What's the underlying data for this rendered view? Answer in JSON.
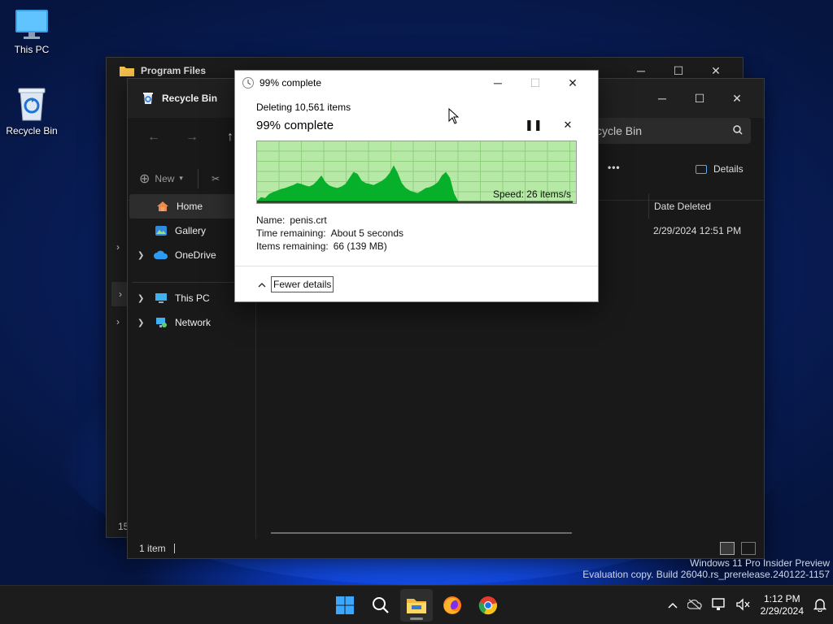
{
  "desktop": {
    "icons": [
      {
        "label": "This PC"
      },
      {
        "label": "Recycle Bin"
      }
    ]
  },
  "back_window": {
    "title": "Program Files",
    "status_count": "15"
  },
  "front_window": {
    "title": "Recycle Bin",
    "search_placeholder": "Search Recycle Bin",
    "search_visible": "cycle Bin",
    "new_label": "New",
    "details_label": "Details",
    "more_label": "•••",
    "nav": [
      {
        "label": "Home",
        "selected": true
      },
      {
        "label": "Gallery"
      },
      {
        "label": "OneDrive"
      },
      {
        "label": "This PC"
      },
      {
        "label": "Network"
      }
    ],
    "column_date_deleted": "Date Deleted",
    "row_date": "2/29/2024 12:51 PM",
    "status": "1 item"
  },
  "dialog": {
    "title": "99% complete",
    "deleting": "Deleting 10,561 items",
    "percent_text": "99% complete",
    "progress": 0.99,
    "speed": "Speed: 26 items/s",
    "name_key": "Name:",
    "name_val": "penis.crt",
    "time_key": "Time remaining:",
    "time_val": "About 5 seconds",
    "items_key": "Items remaining:",
    "items_val": "66 (139 MB)",
    "fewer_details": "Fewer details"
  },
  "watermark": {
    "line1": "Windows 11 Pro Insider Preview",
    "line2": "Evaluation copy. Build 26040.rs_prerelease.240122-1157"
  },
  "taskbar": {
    "time": "1:12 PM",
    "date": "2/29/2024"
  },
  "colors": {
    "graph_fill": "#06b02a",
    "graph_bg": "#b6e8a6",
    "accent": "#0078d4"
  }
}
